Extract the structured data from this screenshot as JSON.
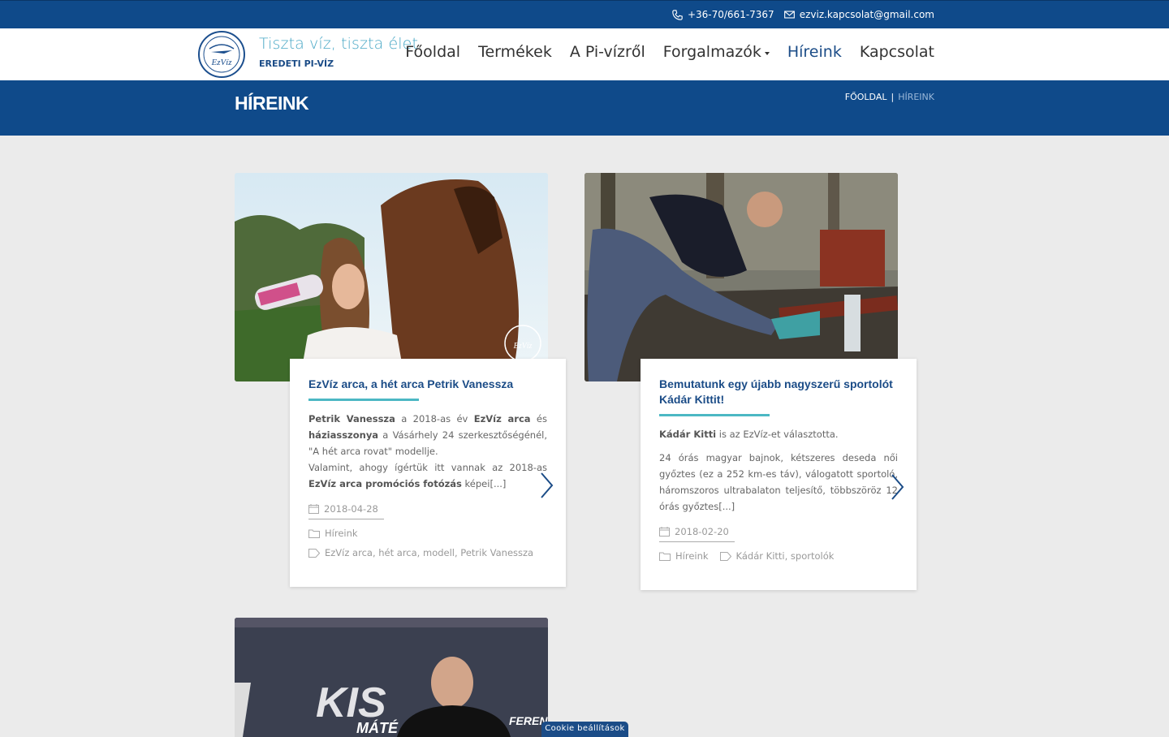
{
  "topbar": {
    "phone": "+36-70/661-7367",
    "email": "ezviz.kapcsolat@gmail.com"
  },
  "brand": {
    "logo_text": "EzVíz",
    "tagline": "Tiszta víz, tiszta élet",
    "subtag": "EREDETI PI-VÍZ"
  },
  "nav": [
    {
      "label": "Főoldal"
    },
    {
      "label": "Termékek"
    },
    {
      "label": "A Pi-vízről"
    },
    {
      "label": "Forgalmazók"
    },
    {
      "label": "Híreink"
    },
    {
      "label": "Kapcsolat"
    }
  ],
  "page": {
    "title": "HÍREINK",
    "breadcrumb_home": "FŐOLDAL",
    "breadcrumb_sep": "|",
    "breadcrumb_current": "HÍREINK"
  },
  "posts": [
    {
      "title": "EzVíz arca, a hét arca Petrik Vanessza",
      "p1_b1": "Petrik Vanessza",
      "p1_t1": " a 2018-as év ",
      "p1_b2": "EzVíz arca",
      "p1_t2": " és ",
      "p1_b3": "háziasszonya",
      "p1_t3": " a Vásárhely 24 szerkesztőségénél, \"A hét arca rovat\" modellje.",
      "p2_t1": "Valamint, ahogy ígértük itt vannak az 2018-as ",
      "p2_b1": "EzVíz arca promóciós fotózás",
      "p2_t2": " képei[...]",
      "date": "2018-04-28",
      "category": "Híreink",
      "tags": "EzVíz arca, hét arca, modell, Petrik Vanessza"
    },
    {
      "title": "Bemutatunk egy újabb nagyszerű sportolót Kádár Kittit!",
      "p1_b1": "Kádár Kitti",
      "p1_t1": " is az EzVíz-et választotta.",
      "p2": "24 órás magyar bajnok, kétszeres deseda női győztes (ez a 252 km-es táv), válogatott sportoló, háromszoros ultrabalaton teljesítő, többszöröz 12 órás győztes[...]",
      "date": "2018-02-20",
      "category": "Híreink",
      "tags": "Kádár Kitti, sportolók"
    }
  ],
  "third_post": {
    "banner_text_1": "KIS",
    "banner_text_2": "MÁTÉ",
    "banner_text_3": "FEREN"
  },
  "cookie": {
    "label": "Cookie beállítások"
  },
  "colors": {
    "primary": "#0f4a8a",
    "accent": "#4cb8c4",
    "title": "#1b4c87"
  }
}
